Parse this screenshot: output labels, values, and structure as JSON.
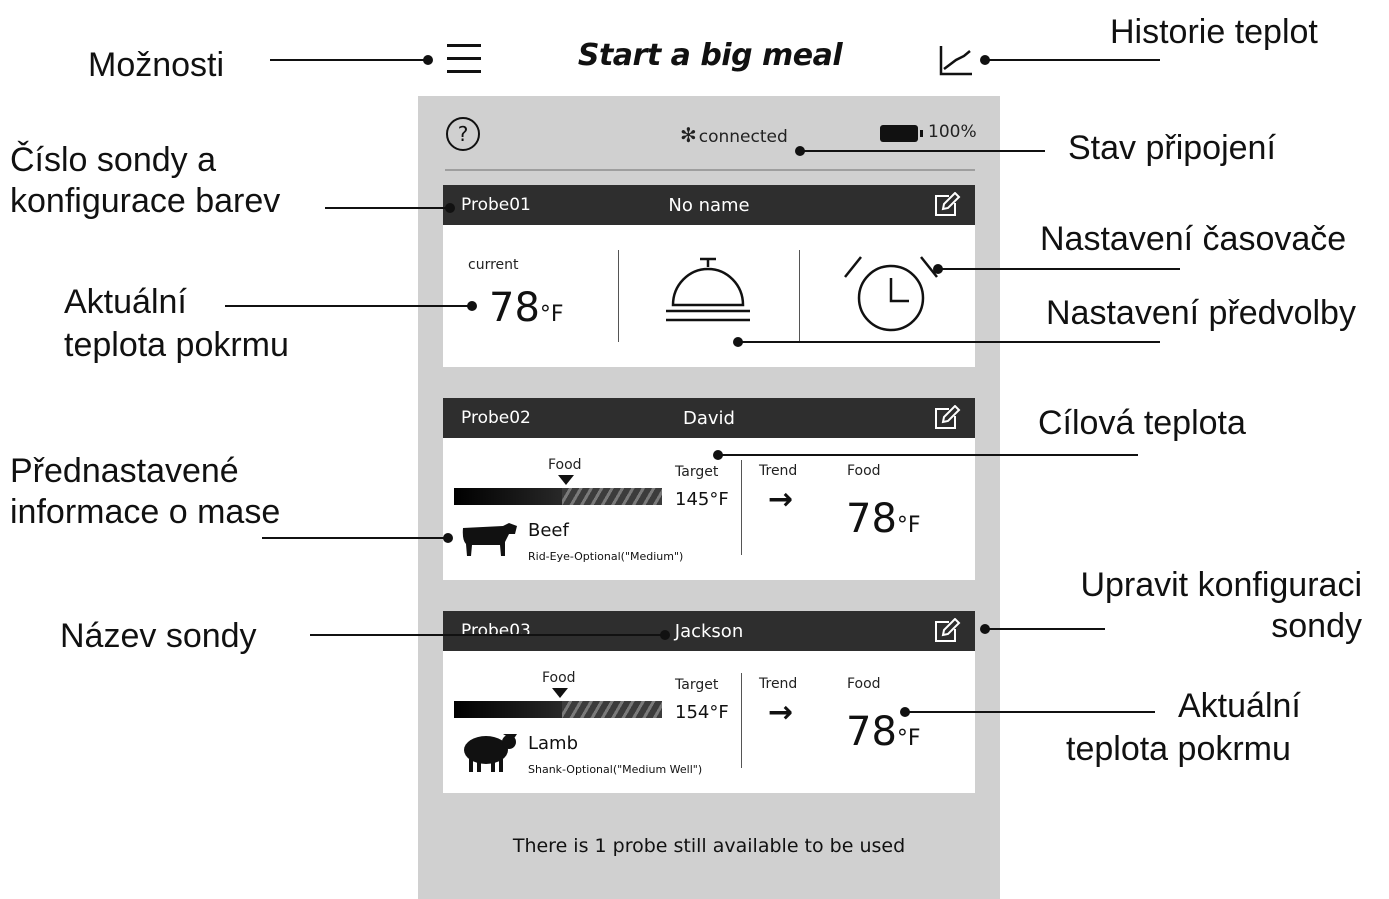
{
  "header": {
    "title": "Start a big meal",
    "menu_icon": "hamburger-menu-icon",
    "history_icon": "line-chart-icon"
  },
  "status": {
    "help_icon": "question-circle-icon",
    "bluetooth_icon": "bluetooth-icon",
    "connection": "connected",
    "battery_icon": "battery-icon",
    "battery_level": "100%"
  },
  "probes": [
    {
      "id": "Probe01",
      "name": "No name",
      "current_label": "current",
      "current_temp": "78",
      "unit": "°F",
      "preset_icon": "serving-bell-icon",
      "timer_icon": "alarm-clock-icon"
    },
    {
      "id": "Probe02",
      "name": "David",
      "food_label": "Food",
      "target_label": "Target",
      "target_temp": "145°F",
      "trend_label": "Trend",
      "trend_arrow": "→",
      "food_temp_label": "Food",
      "food_temp": "78",
      "unit": "°F",
      "meat": "Beef",
      "meat_icon": "cow-icon",
      "cut": "Rid-Eye-Optional(\"Medium\")"
    },
    {
      "id": "Probe03",
      "name": "Jackson",
      "food_label": "Food",
      "target_label": "Target",
      "target_temp": "154°F",
      "trend_label": "Trend",
      "trend_arrow": "→",
      "food_temp_label": "Food",
      "food_temp": "78",
      "unit": "°F",
      "meat": "Lamb",
      "meat_icon": "sheep-icon",
      "cut": "Shank-Optional(\"Medium Well\")"
    }
  ],
  "footer": {
    "available": "There is 1 probe still available to be used"
  },
  "callouts": {
    "moznosti": "Možnosti",
    "historie": "Historie teplot",
    "cislo_sondy_1": "Číslo sondy a",
    "cislo_sondy_2": "konfigurace barev",
    "stav": "Stav připojení",
    "casovac": "Nastavení časovače",
    "aktualni_1a": "Aktuální",
    "aktualni_1b": "teplota pokrmu",
    "predvolba": "Nastavení předvolby",
    "cilova": "Cílová teplota",
    "prednast_1": "Přednastavené",
    "prednast_2": "informace o mase",
    "upravit_1": "Upravit konfiguraci",
    "upravit_2": "sondy",
    "nazev": "Název sondy",
    "aktualni_2a": "Aktuální",
    "aktualni_2b": "teplota pokrmu"
  }
}
